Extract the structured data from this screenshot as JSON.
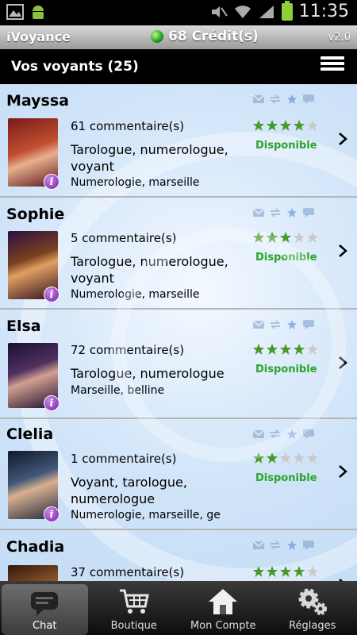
{
  "status_bar": {
    "time": "11:35"
  },
  "app_bar": {
    "title": "iVoyance",
    "credits": "68 Crédit(s)",
    "version": "v2.0"
  },
  "sub_bar": {
    "title": "Vos voyants (25)"
  },
  "colors": {
    "available": "#2aa52a",
    "star_on": "#4a9a2a",
    "star_off": "#c9c9c9",
    "badge": "#7a1fa8"
  },
  "psychics": [
    {
      "name": "Mayssa",
      "comments": "61 commentaire(s)",
      "specialty": "Tarologue, numerologue, voyant",
      "tags": "Numerologie, marseille",
      "rating": 4,
      "status": "Disponible"
    },
    {
      "name": "Sophie",
      "comments": "5 commentaire(s)",
      "specialty": "Tarologue, numerologue, voyant",
      "tags": "Numerologie, marseille",
      "rating": 3,
      "status": "Disponible"
    },
    {
      "name": "Elsa",
      "comments": "72 commentaire(s)",
      "specialty": "Tarologue, numerologue",
      "tags": "Marseille, belline",
      "rating": 4,
      "status": "Disponible"
    },
    {
      "name": "Clelia",
      "comments": "1 commentaire(s)",
      "specialty": "Voyant, tarologue, numerologue",
      "tags": "Numerologie, marseille, ge",
      "rating": 2,
      "status": "Disponible"
    },
    {
      "name": "Chadia",
      "comments": "37 commentaire(s)",
      "specialty": "",
      "tags": "",
      "rating": 4,
      "status": ""
    }
  ],
  "tabs": [
    {
      "label": "Chat",
      "icon": "chat-bubble-icon"
    },
    {
      "label": "Boutique",
      "icon": "shopping-cart-icon"
    },
    {
      "label": "Mon Compte",
      "icon": "home-icon"
    },
    {
      "label": "Réglages",
      "icon": "gears-icon"
    }
  ]
}
